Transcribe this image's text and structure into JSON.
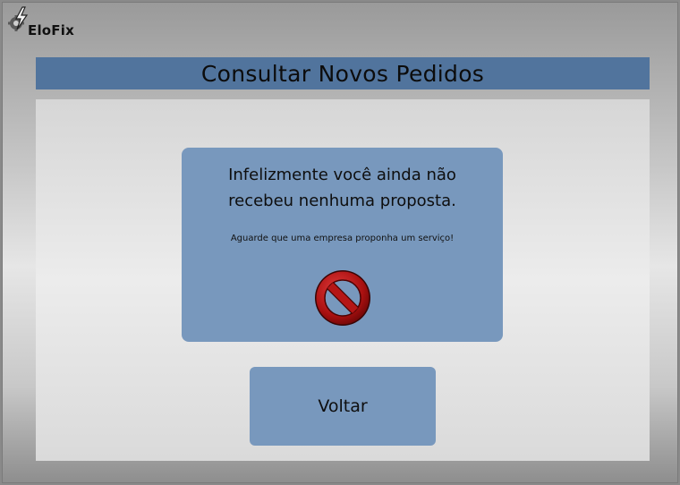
{
  "brand": {
    "name": "EloFix",
    "icon": "lightning-gear-icon"
  },
  "header": {
    "title": "Consultar Novos Pedidos"
  },
  "message": {
    "main": "Infelizmente você ainda não recebeu nenhuma proposta.",
    "sub": "Aguarde que uma empresa proponha um serviço!",
    "icon": "no-entry-icon"
  },
  "actions": {
    "back_label": "Voltar"
  },
  "colors": {
    "accent": "#51749d",
    "box": "#7898bd",
    "no_entry_red": "#b01515"
  }
}
